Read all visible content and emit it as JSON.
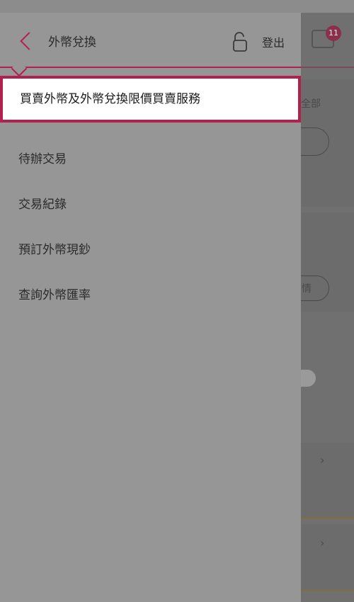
{
  "header": {
    "title": "外幣兌換",
    "logout_label": "登出",
    "mail_badge_count": "11"
  },
  "menu": {
    "items": [
      {
        "label": "買賣外幣及外幣兌換限價買賣服務",
        "selected": true
      },
      {
        "label": "待辦交易"
      },
      {
        "label": "交易紀錄"
      },
      {
        "label": "預訂外幣現鈔"
      },
      {
        "label": "查詢外幣匯率"
      }
    ]
  },
  "background": {
    "show_all_label": "全部",
    "detail_pill_label": "情",
    "chevron_glyph": "›"
  },
  "colors": {
    "accent": "#b2204d",
    "drawer_bg": "#969696",
    "overlay_bg": "#707070"
  }
}
